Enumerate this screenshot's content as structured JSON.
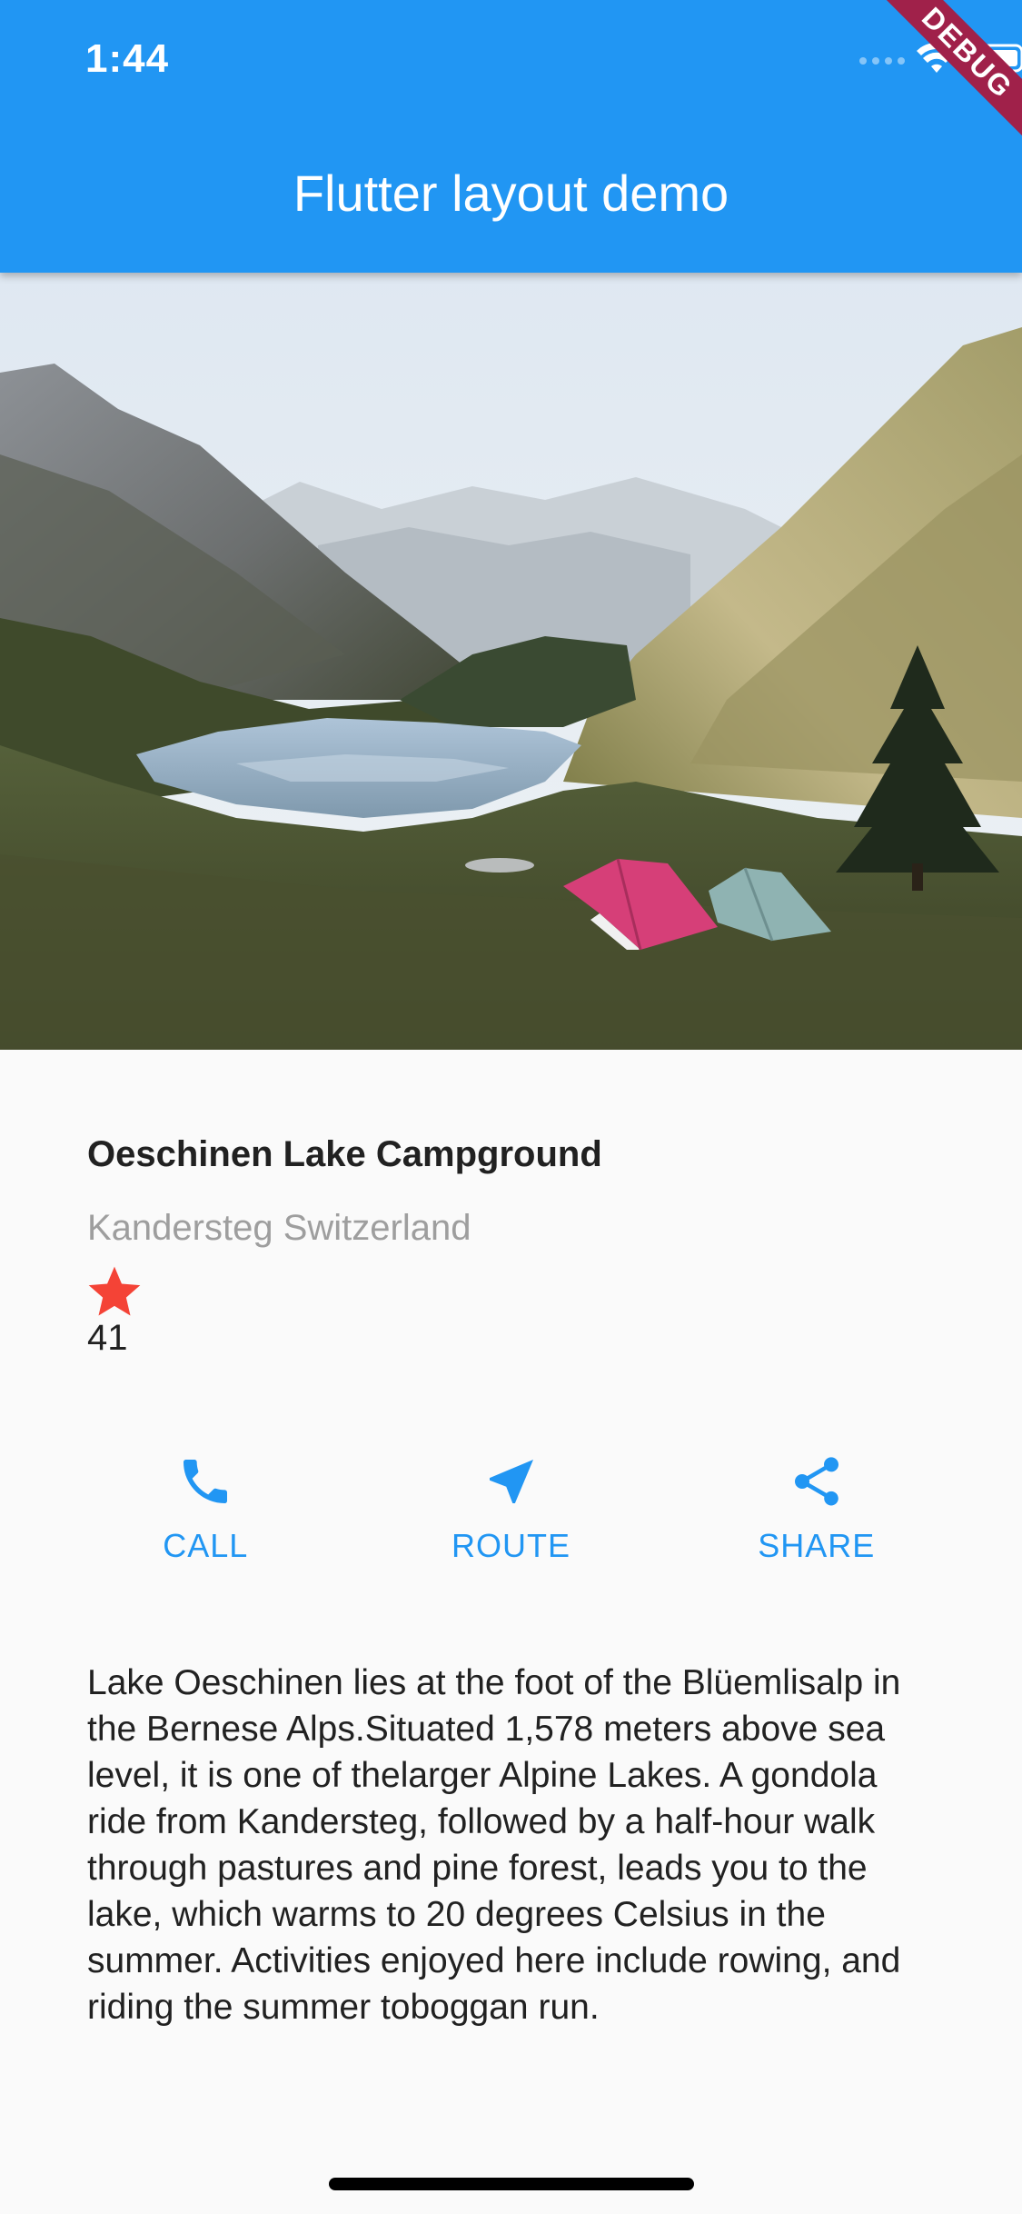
{
  "status_bar": {
    "time": "1:44"
  },
  "app_bar": {
    "title": "Flutter layout demo",
    "color": "#2196f3"
  },
  "debug_banner": {
    "label": "DEBUG",
    "color": "#a0214a"
  },
  "place": {
    "name": "Oeschinen Lake Campground",
    "location": "Kandersteg Switzerland",
    "rating_icon": "star-icon",
    "rating_count": "41",
    "star_color": "#f44336"
  },
  "actions": [
    {
      "icon": "phone-icon",
      "label": "CALL"
    },
    {
      "icon": "navigation-icon",
      "label": "ROUTE"
    },
    {
      "icon": "share-icon",
      "label": "SHARE"
    }
  ],
  "description": "Lake Oeschinen lies at the foot of the Blüemlisalp in the Bernese Alps.Situated 1,578 meters above sea level, it is one of thelarger Alpine Lakes. A gondola ride from Kandersteg, followed by a half-hour walk through pastures and pine forest, leads you to the lake, which warms to 20 degrees Celsius in the summer. Activities enjoyed here include rowing, and riding the summer toboggan run.",
  "accent_color": "#2196f3"
}
